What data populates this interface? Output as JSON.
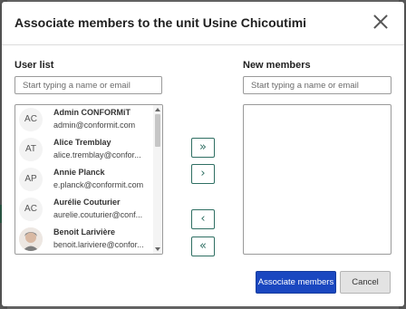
{
  "dialog": {
    "title": "Associate members to the unit Usine Chicoutimi",
    "close_icon": "close-icon"
  },
  "user_list": {
    "label": "User list",
    "search_placeholder": "Start typing a name or email",
    "items": [
      {
        "initials": "AC",
        "name": "Admin CONFORMiT",
        "email": "admin@conformit.com",
        "avatar": "initials"
      },
      {
        "initials": "AT",
        "name": "Alice Tremblay",
        "email": "alice.tremblay@confor...",
        "avatar": "initials"
      },
      {
        "initials": "AP",
        "name": "Annie Planck",
        "email": "e.planck@conformit.com",
        "avatar": "initials"
      },
      {
        "initials": "AC",
        "name": "Aurélie Couturier",
        "email": "aurelie.couturier@conf...",
        "avatar": "initials"
      },
      {
        "initials": "",
        "name": "Benoit Larivière",
        "email": "benoit.lariviere@confor...",
        "avatar": "photo"
      }
    ]
  },
  "new_members": {
    "label": "New members",
    "search_placeholder": "Start typing a name or email",
    "items": []
  },
  "transfer": {
    "add_all": "»",
    "add_one": "›",
    "remove_one": "‹",
    "remove_all": "«"
  },
  "actions": {
    "associate_label": "Associate members",
    "cancel_label": "Cancel"
  },
  "colors": {
    "primary": "#1a47c0",
    "transfer_accent": "#2f6f63"
  }
}
